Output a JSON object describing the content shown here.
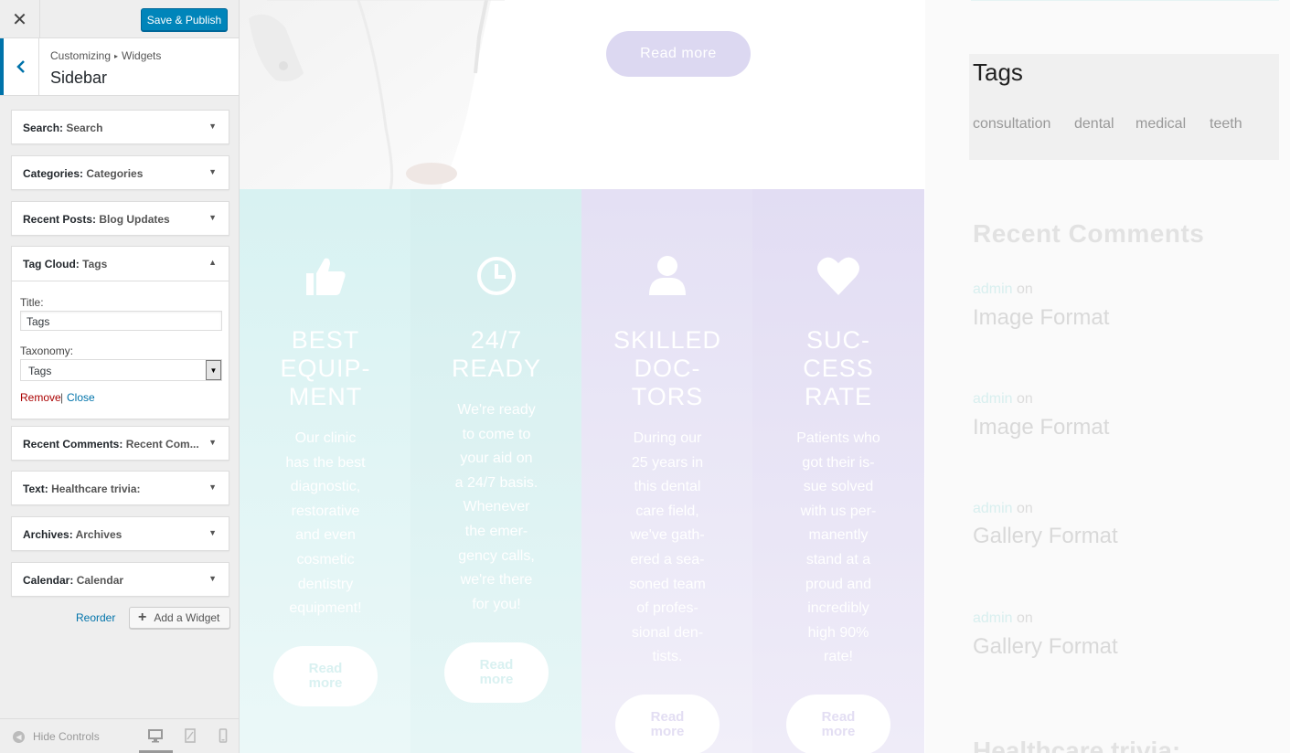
{
  "customizer": {
    "close_glyph": "✕",
    "save_label": "Save & Publish",
    "breadcrumb": [
      "Customizing",
      "Widgets"
    ],
    "section_title": "Sidebar",
    "widgets": [
      {
        "type": "Search",
        "instance": "Search"
      },
      {
        "type": "Categories",
        "instance": "Categories"
      },
      {
        "type": "Recent Posts",
        "instance": "Blog Updates"
      },
      {
        "type": "Tag Cloud",
        "instance": "Tags"
      },
      {
        "type": "Recent Comments",
        "instance": "Recent Com..."
      },
      {
        "type": "Text",
        "instance": "Healthcare trivia:"
      },
      {
        "type": "Archives",
        "instance": "Archives"
      },
      {
        "type": "Calendar",
        "instance": "Calendar"
      }
    ],
    "tag_cloud_form": {
      "title_label": "Title:",
      "title_value": "Tags",
      "taxonomy_label": "Taxonomy:",
      "taxonomy_value": "Tags",
      "remove_label": "Remove",
      "separator": "|",
      "close_label": "Close"
    },
    "reorder_label": "Reorder",
    "add_widget_label": "Add a Widget",
    "hide_controls_label": "Hide Controls"
  },
  "preview": {
    "hero_button": "Read more",
    "features": [
      {
        "icon": "thumbs-up-icon",
        "title": "BEST EQUIP-MENT",
        "title_lines": [
          "BEST",
          "EQUIP-",
          "MENT"
        ],
        "text_lines": [
          "Our clinic",
          "has the best",
          "diagnostic,",
          "restorative",
          "and even",
          "cosmetic",
          "dentistry",
          "equipment!"
        ],
        "button": "Read more"
      },
      {
        "icon": "clock-icon",
        "title": "24/7 READY",
        "title_lines": [
          "24/7",
          "READY"
        ],
        "text_lines": [
          "We're ready",
          "to come to",
          "your aid on",
          "a 24/7 basis.",
          "Whenever",
          "the emer-",
          "gency calls,",
          "we're there",
          "for you!"
        ],
        "button": "Read more"
      },
      {
        "icon": "user-icon",
        "title": "SKILLED DOC-TORS",
        "title_lines": [
          "SKILLED",
          "DOC-",
          "TORS"
        ],
        "text_lines": [
          "During our",
          "25 years in",
          "this dental",
          "care field,",
          "we've gath-",
          "ered a sea-",
          "soned team",
          "of profes-",
          "sional den-",
          "tists."
        ],
        "button": "Read more"
      },
      {
        "icon": "heart-icon",
        "title": "SUC-CESS RATE",
        "title_lines": [
          "SUC-",
          "CESS",
          "RATE"
        ],
        "text_lines": [
          "Patients who",
          "got their is-",
          "sue solved",
          "with us per-",
          "manently",
          "stand at a",
          "proud and",
          "incredibly",
          "high 90%",
          "rate!"
        ],
        "button": "Read more"
      }
    ],
    "sidebar": {
      "tags_title": "Tags",
      "tags": [
        "consultation",
        "dental",
        "medical",
        "teeth"
      ],
      "recent_comments_title": "Recent Comments",
      "comments": [
        {
          "author": "admin",
          "on": "on",
          "post": "Image Format"
        },
        {
          "author": "admin",
          "on": "on",
          "post": "Image Format"
        },
        {
          "author": "admin",
          "on": "on",
          "post": "Gallery Format"
        },
        {
          "author": "admin",
          "on": "on",
          "post": "Gallery Format"
        }
      ],
      "next_widget_title": "Healthcare trivia:"
    }
  },
  "colors": {
    "primary_button": "#0085ba",
    "link": "#0073aa",
    "remove_link": "#a00"
  }
}
